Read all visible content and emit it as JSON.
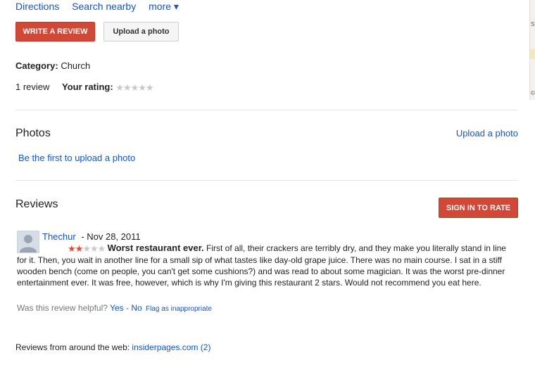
{
  "nav": {
    "directions": "Directions",
    "search_nearby": "Search nearby",
    "more": "more ▾"
  },
  "actions": {
    "write_review": "WRITE A REVIEW",
    "upload_photo": "Upload a photo"
  },
  "place": {
    "category_label": "Category:",
    "category_value": "Church",
    "review_count": "1 review",
    "your_rating_label": "Your rating:",
    "your_rating_stars": 0
  },
  "photos": {
    "heading": "Photos",
    "upload_link": "Upload a photo",
    "first_upload": "Be the first to upload a photo"
  },
  "reviews": {
    "heading": "Reviews",
    "sign_in_button": "SIGN IN TO RATE",
    "items": [
      {
        "author": "Thechur",
        "date": "- Nov 28, 2011",
        "rating": 2,
        "title": "Worst restaurant ever.",
        "body": "First of all, their crackers are terribly dry, and they make you literally stand in line for it. Then, you wait in another line for a small sip of what tastes like day-old grape juice. There was no main course. I sat in a stiff wooden bench (come on people, you can't get some cushions?) and was read to about some magician. It was the worst pre-dinner entertainment ever. It was free, however, which is why I'm giving this restaurant 2 stars. Would not recommend you eat here.",
        "helpful_label": "Was this review helpful?",
        "yes": "Yes",
        "sep": "-",
        "no": "No",
        "flag": "Flag as inappropriate"
      }
    ],
    "from_web_label": "Reviews from around the web:",
    "from_web_link": "insiderpages.com (2)"
  },
  "map": {
    "street_fragment": "St",
    "copyright_fragment": "©"
  },
  "colors": {
    "link": "#1155cc",
    "accent_red": "#d14836",
    "star_on": "#dd4b39",
    "star_off": "#c8c8c8"
  }
}
